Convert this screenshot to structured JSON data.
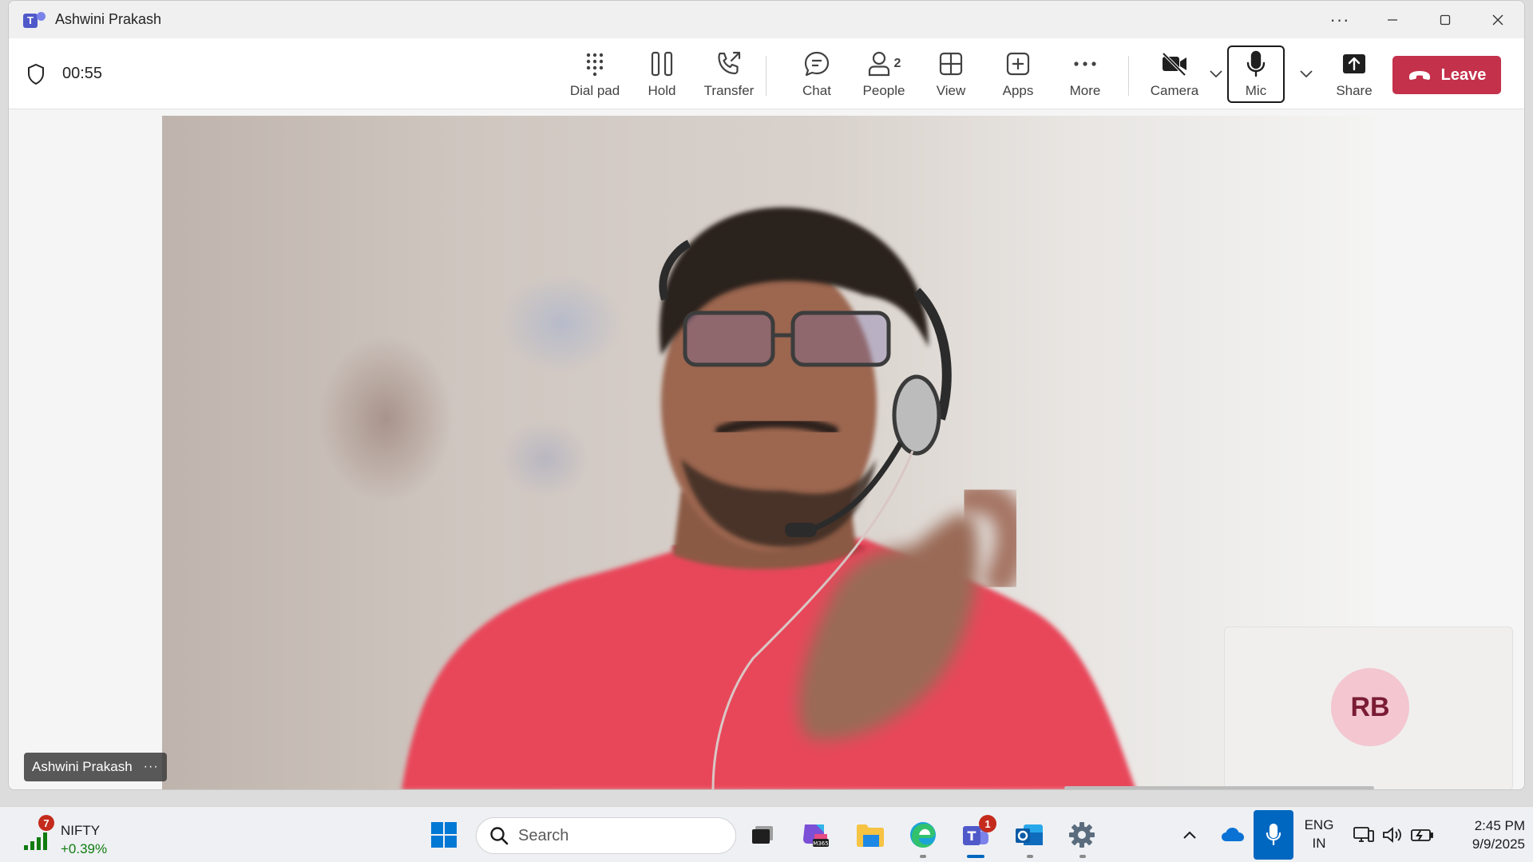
{
  "window": {
    "title": "Ashwini Prakash"
  },
  "call": {
    "duration": "00:55"
  },
  "toolbar": {
    "dial_pad": "Dial pad",
    "hold": "Hold",
    "transfer": "Transfer",
    "chat": "Chat",
    "people": "People",
    "people_count": "2",
    "view": "View",
    "apps": "Apps",
    "more": "More",
    "camera": "Camera",
    "mic": "Mic",
    "share": "Share",
    "leave": "Leave"
  },
  "stage": {
    "participant_name": "Ashwini Prakash",
    "self_initials": "RB"
  },
  "taskbar": {
    "widget": {
      "badge": "7",
      "name": "NIFTY",
      "change": "+0.39%"
    },
    "search_label": "Search",
    "teams_badge": "1",
    "language": "ENG",
    "region": "IN",
    "time": "2:45 PM",
    "date": "9/9/2025"
  },
  "colors": {
    "leave": "#c4314b",
    "teams_brand": "#5b5fc7",
    "avatar_bg": "#f3c6d0",
    "avatar_text": "#7a1c34",
    "gain": "#107c10",
    "badge": "#c42b1c",
    "accent": "#0067c0"
  },
  "icons": {
    "title_more": "more-horizontal-icon",
    "minimize": "minimize-icon",
    "maximize": "maximize-icon",
    "close": "close-icon",
    "shield": "shield-icon",
    "dial_pad": "dialpad-icon",
    "hold": "pause-icon",
    "transfer": "call-transfer-icon",
    "chat": "chat-bubble-icon",
    "people": "person-icon",
    "view": "grid-view-icon",
    "apps": "add-square-icon",
    "more": "more-horizontal-icon",
    "camera": "video-off-icon",
    "mic": "microphone-icon",
    "share": "share-screen-icon",
    "leave": "phone-hangup-icon"
  }
}
